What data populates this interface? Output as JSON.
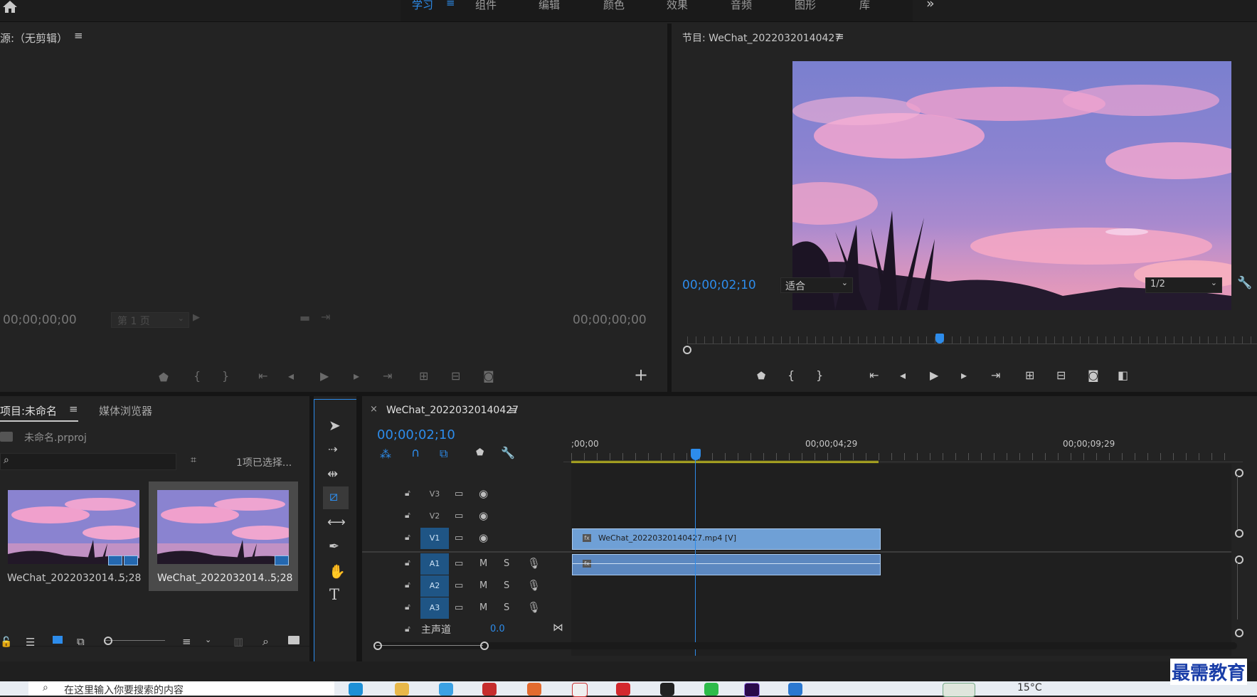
{
  "workspaces": {
    "items": [
      "学习",
      "组件",
      "编辑",
      "颜色",
      "效果",
      "音频",
      "图形",
      "库"
    ],
    "active_index": 0,
    "more": "»"
  },
  "source_monitor": {
    "title": "源:（无剪辑）",
    "menu": "≡",
    "timecode_in": "00;00;00;00",
    "page_label": "第 1 页",
    "timecode_out": "00;00;00;00",
    "add": "+"
  },
  "program_monitor": {
    "title": "节目: WeChat_20220320140427",
    "menu": "≡",
    "timecode": "00;00;02;10",
    "fit_label": "适合",
    "resolution": "1/2",
    "playhead_fraction": 0.443
  },
  "project_panel": {
    "title": "项目:未命名",
    "menu": "≡",
    "tab_media_browser": "媒体浏览器",
    "file_name": "未命名.prproj",
    "search_placeholder": "",
    "selection_status": "1项已选择...",
    "clips": [
      {
        "name": "WeChat_2022032014...",
        "duration": "5;28",
        "selected": false
      },
      {
        "name": "WeChat_2022032014...",
        "duration": "5;28",
        "selected": true
      }
    ]
  },
  "timeline": {
    "close": "×",
    "sequence_name": "WeChat_20220320140427",
    "menu": "≡",
    "timecode": "00;00;02;10",
    "ruler": [
      ";00;00",
      "00;00;04;29",
      "00;00;09;29"
    ],
    "video_tracks": [
      "V3",
      "V2",
      "V1"
    ],
    "audio_tracks": [
      "A1",
      "A2",
      "A3"
    ],
    "master_label": "主声道",
    "master_value": "0.0",
    "video_clip_label": "WeChat_20220320140427.mp4 [V]",
    "fx_label": "fx",
    "mute": "M",
    "solo": "S"
  },
  "taskbar": {
    "search_placeholder": "在这里输入你要搜索的内容",
    "weather": "15°C"
  },
  "watermark": "最需教育",
  "colors": {
    "accent": "#2d8ceb",
    "clip_video": "#6fa0d6",
    "clip_audio": "#5c88c0",
    "work_area": "#e8e010",
    "track_target": "#1f5585"
  }
}
